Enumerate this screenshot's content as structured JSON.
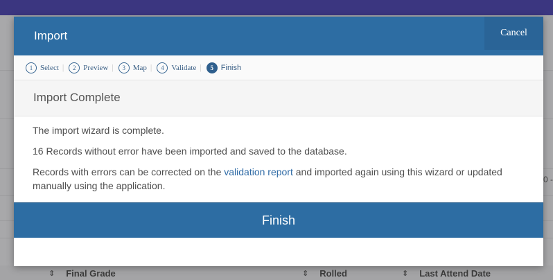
{
  "modal": {
    "title": "Import",
    "cancel_label": "Cancel",
    "steps": [
      {
        "num": "1",
        "label": "Select"
      },
      {
        "num": "2",
        "label": "Preview"
      },
      {
        "num": "3",
        "label": "Map"
      },
      {
        "num": "4",
        "label": "Validate"
      },
      {
        "num": "5",
        "label": "Finish"
      }
    ],
    "step_separator": "|",
    "section_title": "Import Complete",
    "message_1": "The import wizard is complete.",
    "message_2": "16 Records without error have been imported and saved to the database.",
    "message_3_before": "Records with errors can be corrected on the ",
    "message_3_link": "validation report",
    "message_3_after": " and imported again using this wizard or updated manually using the application.",
    "finish_label": "Finish"
  },
  "background": {
    "columns": [
      "Final Grade",
      "Rolled",
      "Last Attend Date"
    ],
    "sort_icon": "sort-icon",
    "edge_text": "0 -"
  },
  "colors": {
    "header_blue": "#2d6da3",
    "nav_bar": "#3b3680",
    "link": "#2e6aa5"
  }
}
